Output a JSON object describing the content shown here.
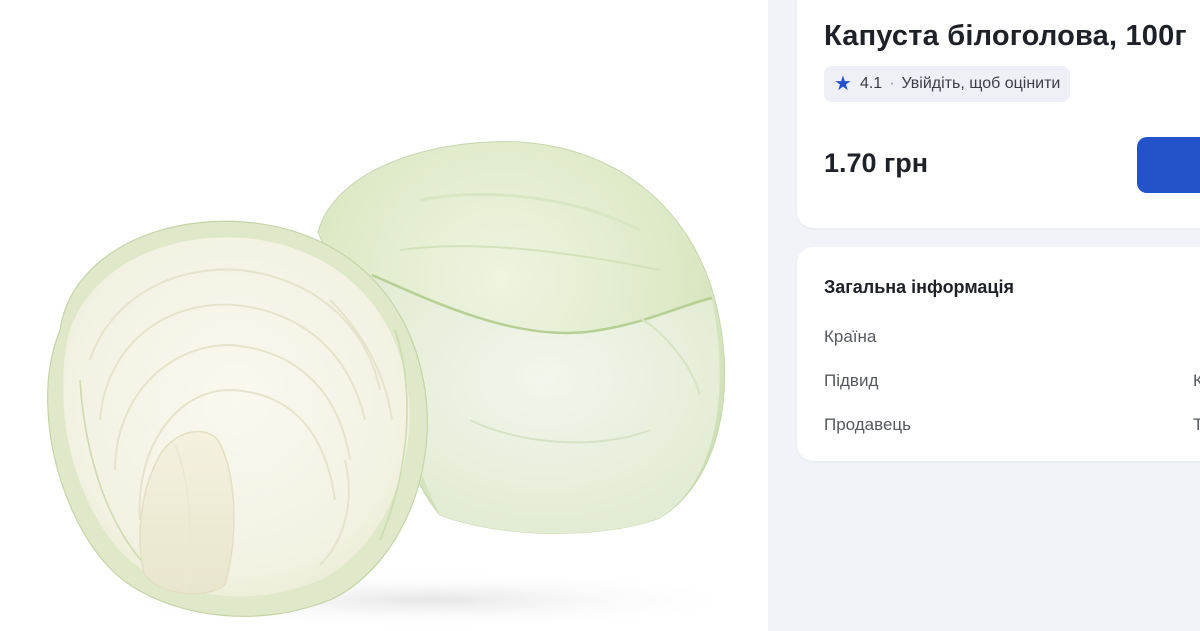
{
  "product": {
    "title": "Капуста білоголова, 100г",
    "image_alt": "Капуста білоголова"
  },
  "rating": {
    "icon": "star-icon",
    "value": "4.1",
    "separator": "·",
    "login_prompt": "Увійдіть, щоб оцінити"
  },
  "price": {
    "text": "1.70 грн"
  },
  "buy_button": {
    "label": "",
    "color": "#2352c9"
  },
  "info": {
    "title": "Загальна інформація",
    "rows": [
      {
        "label": "Країна",
        "value": ""
      },
      {
        "label": "Підвид",
        "value": "К"
      },
      {
        "label": "Продавець",
        "value": "Т"
      }
    ]
  },
  "colors": {
    "accent": "#2352c9",
    "page_background": "#f1f3f8",
    "card_background": "#ffffff"
  }
}
